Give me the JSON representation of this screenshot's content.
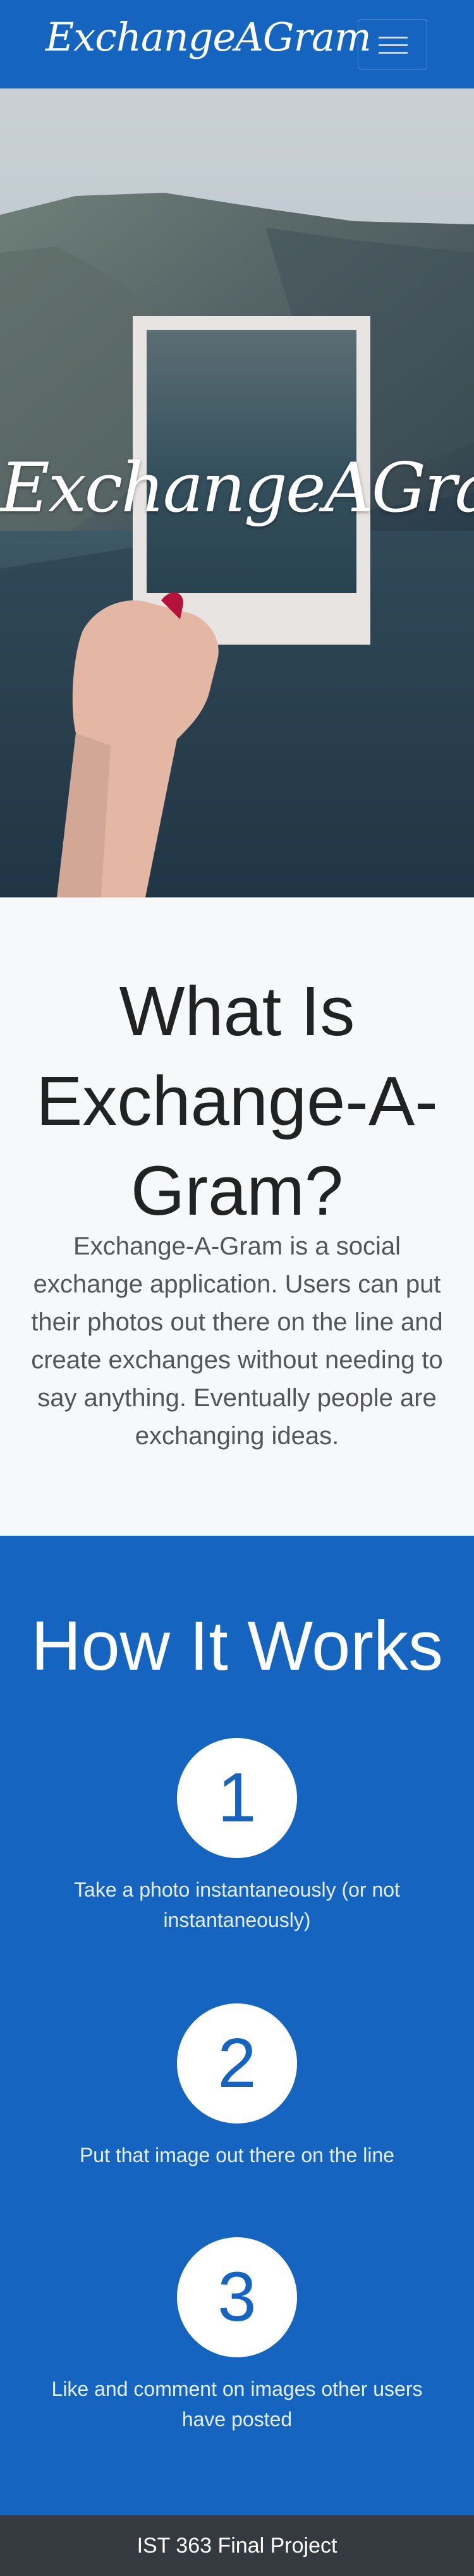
{
  "navbar": {
    "brand": "ExchangeAGram",
    "menu_icon": "hamburger-icon"
  },
  "hero": {
    "title": "ExchangeAGram"
  },
  "about": {
    "heading": "What Is Exchange-A-Gram?",
    "body": "Exchange-A-Gram is a social exchange application. Users can put their photos out there on the line and create exchanges without needing to say anything. Eventually people are exchanging ideas."
  },
  "how": {
    "heading": "How It Works",
    "steps": [
      {
        "number": "1",
        "text": "Take a photo instantaneously (or not instantaneously)"
      },
      {
        "number": "2",
        "text": "Put that image out there on the line"
      },
      {
        "number": "3",
        "text": "Like and comment on images other users have posted"
      }
    ]
  },
  "footer": {
    "text": "IST 363 Final Project"
  },
  "colors": {
    "brand_blue": "#1565c0",
    "footer_dark": "#343a40",
    "about_bg": "#f7f8fa"
  }
}
